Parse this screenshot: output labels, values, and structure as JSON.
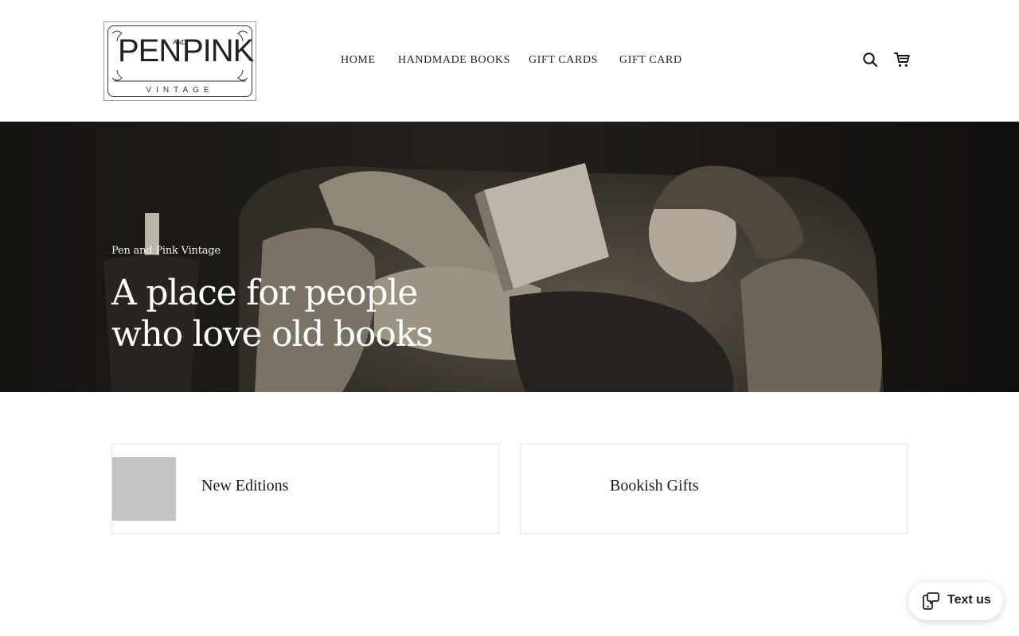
{
  "header": {
    "logo": {
      "word_left": "PEN",
      "word_and": "AND",
      "word_right": "PINK",
      "tagline": "VINTAGE"
    },
    "nav": [
      {
        "label": "HOME"
      },
      {
        "label": "HANDMADE BOOKS"
      },
      {
        "label": "GIFT CARDS"
      },
      {
        "label": "GIFT CARD"
      }
    ],
    "icons": {
      "search": "search-icon",
      "cart": "cart-icon"
    }
  },
  "hero": {
    "eyebrow": "Pen and Pink Vintage",
    "title_line1": "A place for people",
    "title_line2": "who love old books",
    "image": "sepia photo of a woman reclining in an armchair reading a book"
  },
  "collections": [
    {
      "label": "New Editions",
      "has_thumbnail": true
    },
    {
      "label": "Bookish Gifts",
      "has_thumbnail": false
    }
  ],
  "chat_widget": {
    "label": "Text us",
    "icon": "phone-chat-icon"
  },
  "colors": {
    "background": "#ffffff",
    "text": "#1a1a1a",
    "hero_text": "#ffffff",
    "card_border": "#e2e2e2",
    "thumb_placeholder": "#c4c4c4"
  }
}
